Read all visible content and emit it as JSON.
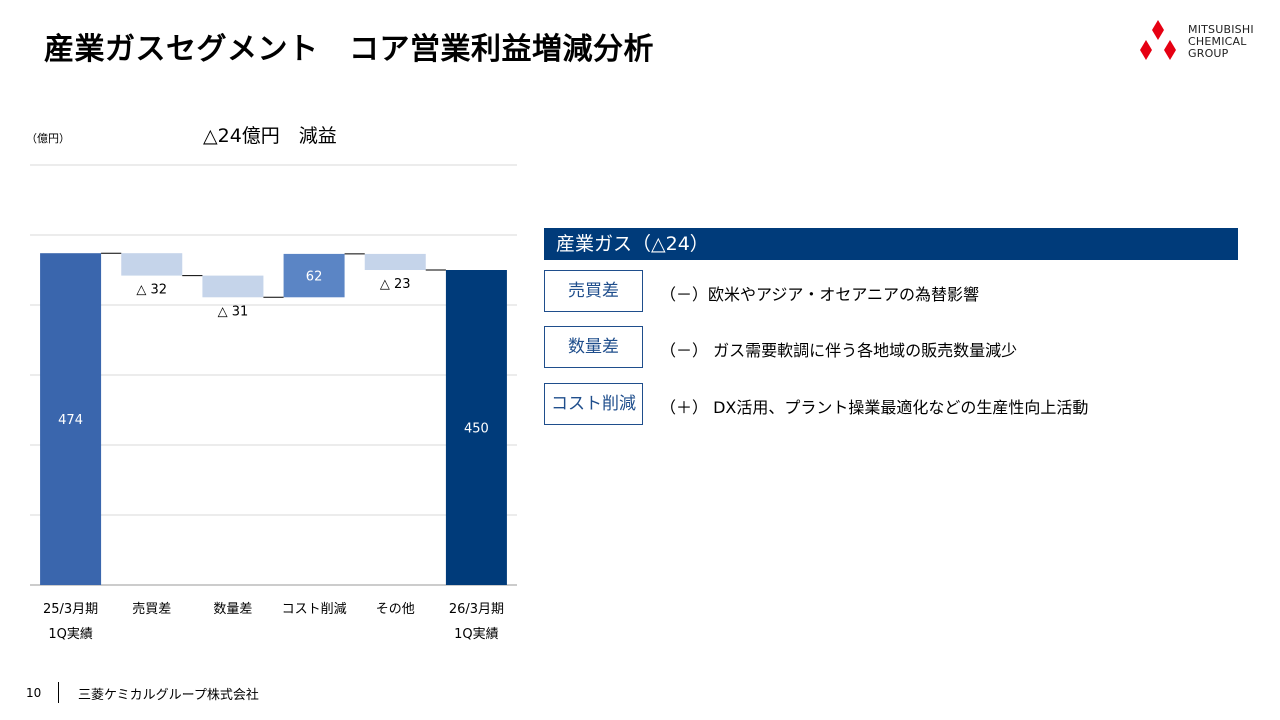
{
  "title": "産業ガスセグメント　コア営業利益増減分析",
  "logo": {
    "text": "MITSUBISHI\nCHEMICAL\nGROUP"
  },
  "unit": "（億円）",
  "headline": "△24億円　減益",
  "panel": {
    "header": "産業ガス（△24）",
    "items": [
      {
        "label": "売買差",
        "text": "（－）欧米やアジア・オセアニアの為替影響"
      },
      {
        "label": "数量差",
        "text": "（－） ガス需要軟調に伴う各地域の販売数量減少"
      },
      {
        "label": "コスト削減",
        "text": "（＋） DX活用、プラント操業最適化などの生産性向上活動"
      }
    ]
  },
  "footer": {
    "page": "10",
    "company": "三菱ケミカルグループ株式会社"
  },
  "colors": {
    "start": "#3a66ad",
    "decrease": "#c5d4ea",
    "increase": "#5b85c5",
    "end": "#003b7a",
    "header": "#003b7a",
    "logo": "#e60012"
  },
  "chart_data": {
    "type": "bar",
    "subtype": "waterfall",
    "categories": [
      "25/3月期\n1Q実績",
      "売買差",
      "数量差",
      "コスト削減",
      "その他",
      "26/3月期\n1Q実績"
    ],
    "values": [
      474,
      -32,
      -31,
      62,
      -23,
      450
    ],
    "kinds": [
      "total",
      "delta",
      "delta",
      "delta",
      "delta",
      "total"
    ],
    "labels": [
      "474",
      "△ 32",
      "△ 31",
      "62",
      "△ 23",
      "450"
    ],
    "ylim": [
      0,
      600
    ],
    "grid": true
  }
}
